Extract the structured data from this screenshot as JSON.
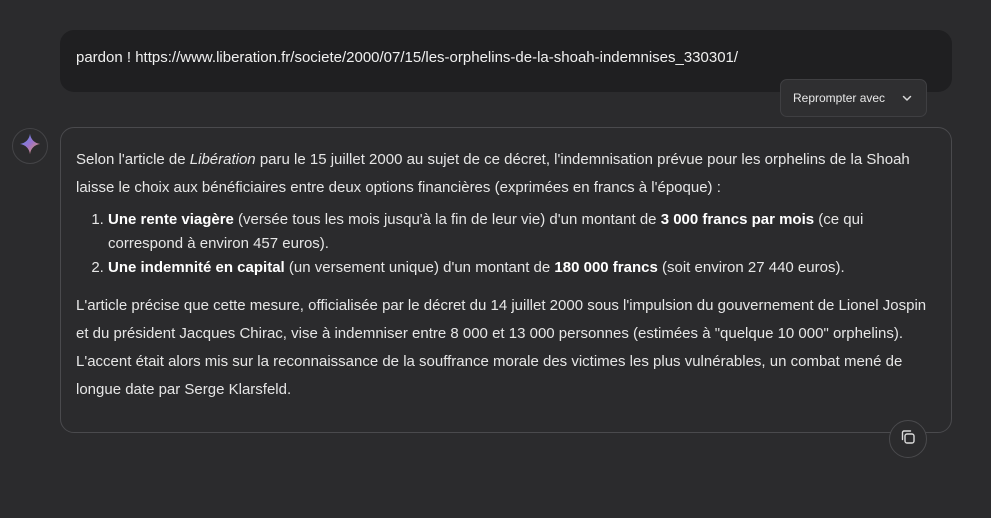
{
  "user_message": {
    "text": "pardon ! https://www.liberation.fr/societe/2000/07/15/les-orphelins-de-la-shoah-indemnises_330301/"
  },
  "reprompt": {
    "label": "Reprompter avec",
    "icon": "chevron-down-icon"
  },
  "assistant": {
    "avatar_icon": "sparkle-icon",
    "intro_before": "Selon l'article de ",
    "intro_italic": "Libération",
    "intro_after": " paru le 15 juillet 2000 au sujet de ce décret, l'indemnisation prévue pour les orphelins de la Shoah laisse le choix aux bénéficiaires entre deux options financières (exprimées en francs à l'époque) :",
    "items": [
      {
        "bold": "Une rente viagère",
        "mid": " (versée tous les mois jusqu'à la fin de leur vie) d'un montant de ",
        "bold2": "3 000 francs par mois",
        "end": " (ce qui correspond à environ 457 euros)."
      },
      {
        "bold": "Une indemnité en capital",
        "mid": " (un versement unique) d'un montant de ",
        "bold2": "180 000 francs",
        "end": " (soit environ 27 440 euros)."
      }
    ],
    "conclusion": "L'article précise que cette mesure, officialisée par le décret du 14 juillet 2000 sous l'impulsion du gouvernement de Lionel Jospin et du président Jacques Chirac, vise à indemniser entre 8 000 et 13 000 personnes (estimées à \"quelque 10 000\" orphelins). L'accent était alors mis sur la reconnaissance de la souffrance morale des victimes les plus vulnérables, un combat mené de longue date par Serge Klarsfeld."
  },
  "copy_button": {
    "icon": "copy-icon"
  }
}
